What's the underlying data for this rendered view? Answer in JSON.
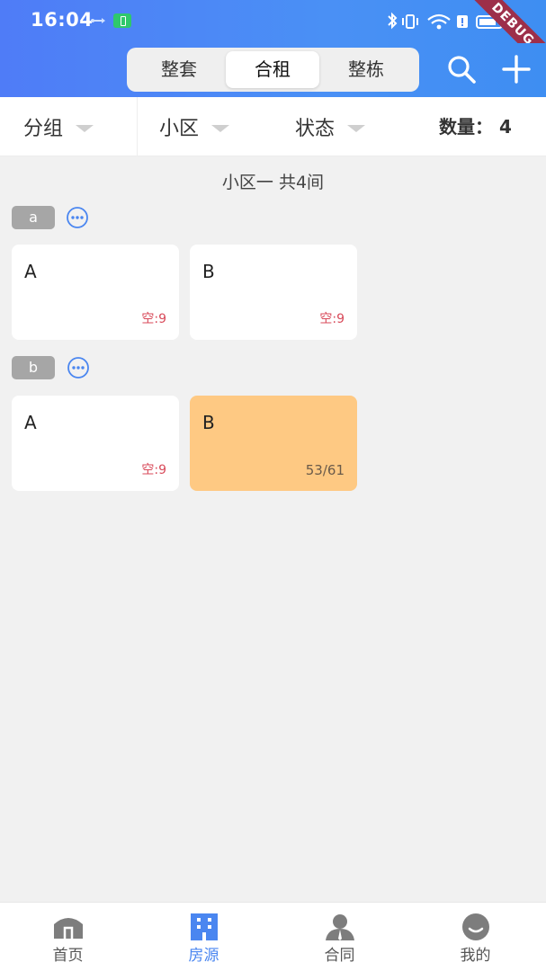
{
  "status_bar": {
    "time": "16:04",
    "debug_label": "DEBUG"
  },
  "header": {
    "tabs": [
      {
        "label": "整套",
        "active": false
      },
      {
        "label": "合租",
        "active": true
      },
      {
        "label": "整栋",
        "active": false
      }
    ]
  },
  "filters": {
    "group_label": "分组",
    "community_label": "小区",
    "status_label": "状态",
    "count_text": "数量： 4"
  },
  "community": {
    "title": "小区一 共4间"
  },
  "groups": [
    {
      "tag": "a",
      "rooms": [
        {
          "name": "A",
          "status": "空:9",
          "occupied": false
        },
        {
          "name": "B",
          "status": "空:9",
          "occupied": false
        }
      ]
    },
    {
      "tag": "b",
      "rooms": [
        {
          "name": "A",
          "status": "空:9",
          "occupied": false
        },
        {
          "name": "B",
          "status": "53/61",
          "occupied": true
        }
      ]
    }
  ],
  "bottom_nav": [
    {
      "label": "首页",
      "icon": "home-icon",
      "active": false
    },
    {
      "label": "房源",
      "icon": "building-icon",
      "active": true
    },
    {
      "label": "合同",
      "icon": "contract-icon",
      "active": false
    },
    {
      "label": "我的",
      "icon": "profile-icon",
      "active": false
    }
  ],
  "colors": {
    "header_gradient_start": "#4f7cf7",
    "header_gradient_end": "#3e8ef2",
    "vacancy_text": "#d84a5a",
    "occupied_card": "#fec983",
    "nav_active": "#4a86f0",
    "group_tag": "#a6a6a6"
  }
}
